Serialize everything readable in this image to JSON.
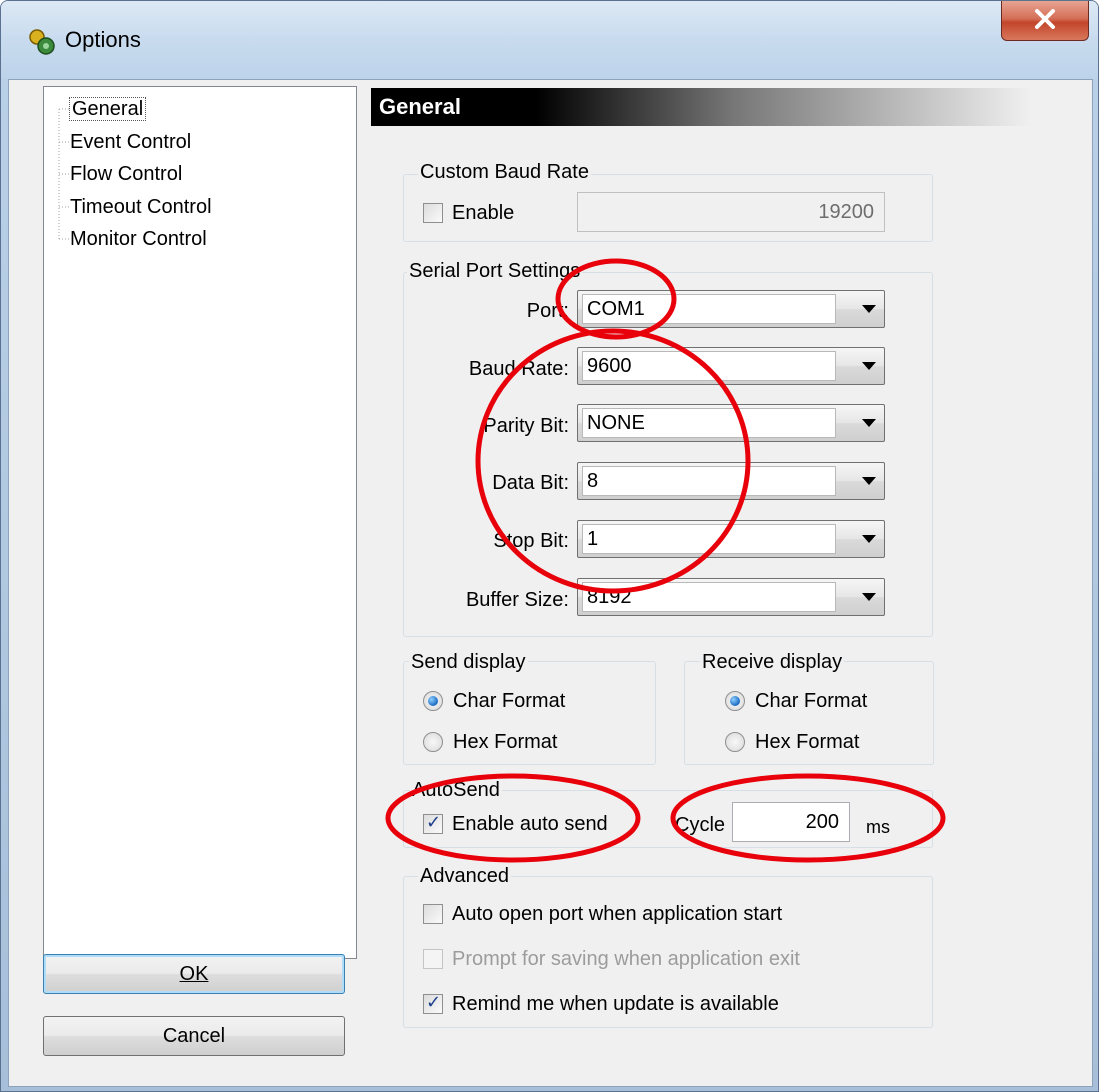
{
  "window": {
    "title": "Options",
    "icon": "app-icon"
  },
  "tree": {
    "items": [
      {
        "label": "General"
      },
      {
        "label": "Event Control"
      },
      {
        "label": "Flow Control"
      },
      {
        "label": "Timeout Control"
      },
      {
        "label": "Monitor Control"
      }
    ]
  },
  "buttons": {
    "ok": "OK",
    "cancel": "Cancel"
  },
  "header": {
    "title": "General"
  },
  "custom_baud": {
    "group": "Custom Baud Rate",
    "enable_label": "Enable",
    "value": "19200",
    "enabled": false
  },
  "serial": {
    "group": "Serial Port Settings",
    "fields": [
      {
        "label": "Port:",
        "value": "COM1"
      },
      {
        "label": "Baud Rate:",
        "value": "9600"
      },
      {
        "label": "Parity Bit:",
        "value": "NONE"
      },
      {
        "label": "Data Bit:",
        "value": "8"
      },
      {
        "label": "Stop Bit:",
        "value": "1"
      },
      {
        "label": "Buffer Size:",
        "value": "8192"
      }
    ]
  },
  "send_display": {
    "group": "Send display",
    "char": "Char Format",
    "hex": "Hex  Format",
    "selected": "char"
  },
  "receive_display": {
    "group": "Receive display",
    "char": "Char Format",
    "hex": "Hex  Format",
    "selected": "char"
  },
  "autosend": {
    "group": "AutoSend",
    "enable_label": "Enable auto send",
    "checked": true,
    "cycle_label": "Cycle",
    "cycle_value": "200",
    "unit": "ms"
  },
  "advanced": {
    "group": "Advanced",
    "items": [
      {
        "label": "Auto open port when application start",
        "checked": false,
        "disabled": false
      },
      {
        "label": "Prompt for saving when application exit",
        "checked": false,
        "disabled": true
      },
      {
        "label": "Remind me when update is available",
        "checked": true,
        "disabled": false
      }
    ]
  },
  "colors": {
    "annotation": "#e8000b",
    "selection": "#1a6ac2"
  }
}
